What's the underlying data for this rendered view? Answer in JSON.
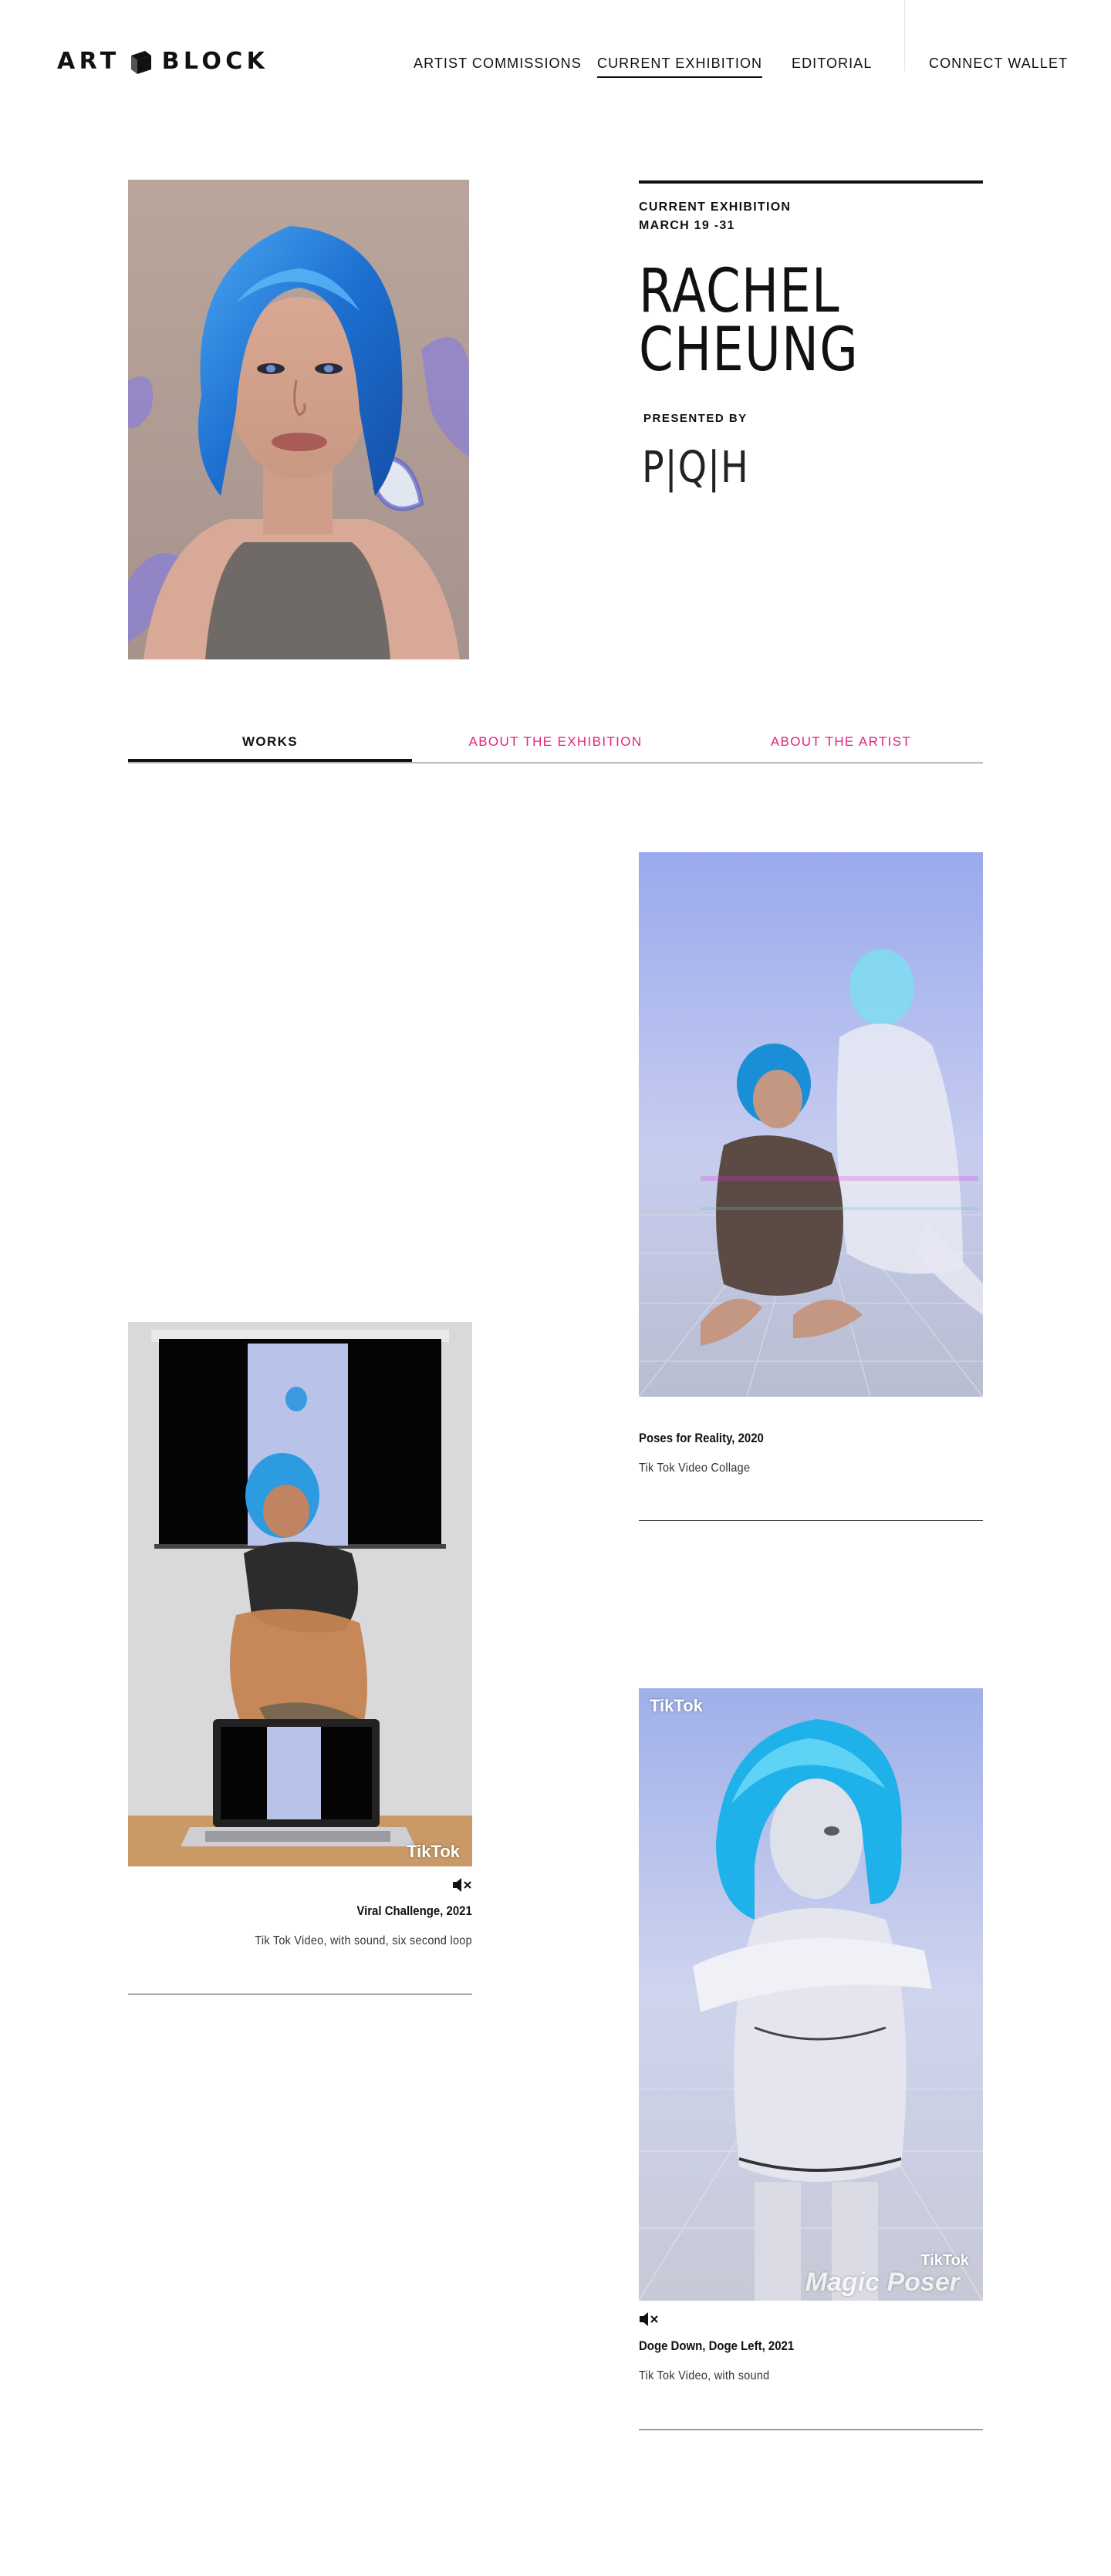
{
  "header": {
    "logo_left": "ART",
    "logo_right": "BLOCK",
    "nav": [
      {
        "label": "ARTIST COMMISSIONS",
        "active": false
      },
      {
        "label": "CURRENT EXHIBITION",
        "active": true
      },
      {
        "label": "EDITORIAL",
        "active": false
      },
      {
        "label": "CONNECT WALLET",
        "active": false
      }
    ]
  },
  "hero": {
    "label": "CURRENT EXHIBITION",
    "dates": "MARCH 19 -31",
    "name_line1": "RACHEL",
    "name_line2": "CHEUNG",
    "presented_by": "PRESENTED BY",
    "presenter_logo": "P|Q|H"
  },
  "tabs": [
    {
      "label": "WORKS",
      "active": true
    },
    {
      "label": "ABOUT THE EXHIBITION",
      "active": false
    },
    {
      "label": "ABOUT THE ARTIST",
      "active": false
    }
  ],
  "works": [
    {
      "title": "Poses for Reality, 2020",
      "description": "Tik Tok Video Collage",
      "muted_icon": false
    },
    {
      "title": "Viral Challenge, 2021",
      "description": "Tik Tok Video, with sound, six second loop",
      "muted_icon": true,
      "watermark": "TikTok"
    },
    {
      "title": "Doge Down, Doge Left, 2021",
      "description": "Tik Tok Video, with sound",
      "muted_icon": true,
      "watermark": "TikTok",
      "watermark2": "TikTok",
      "caption_overlay": "Magic Poser"
    }
  ],
  "colors": {
    "accent_pink": "#e4217f",
    "text": "#111111",
    "hair_blue": "#2a8ce8"
  }
}
